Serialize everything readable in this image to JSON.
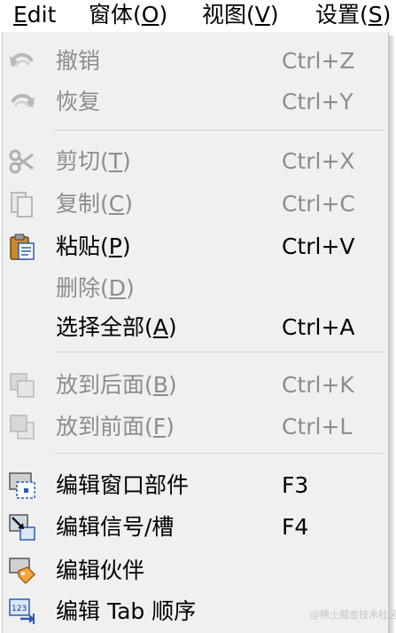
{
  "menubar": {
    "edit": {
      "accel": "E",
      "rest": "dit"
    },
    "window": {
      "pre": "窗体(",
      "accel": "O",
      "post": ")"
    },
    "view": {
      "pre": "视图(",
      "accel": "V",
      "post": ")"
    },
    "settings": {
      "pre": "设置(",
      "accel": "S",
      "post": ")"
    }
  },
  "menu": {
    "undo": {
      "label": "撤销",
      "shortcut": "Ctrl+Z",
      "icon": "undo-icon",
      "enabled": false
    },
    "redo": {
      "label": "恢复",
      "shortcut": "Ctrl+Y",
      "icon": "redo-icon",
      "enabled": false
    },
    "cut": {
      "pre": "剪切(",
      "accel": "T",
      "post": ")",
      "shortcut": "Ctrl+X",
      "icon": "scissors-icon",
      "enabled": false
    },
    "copy": {
      "pre": "复制(",
      "accel": "C",
      "post": ")",
      "shortcut": "Ctrl+C",
      "icon": "copy-icon",
      "enabled": false
    },
    "paste": {
      "pre": "粘贴(",
      "accel": "P",
      "post": ")",
      "shortcut": "Ctrl+V",
      "icon": "paste-icon",
      "enabled": true
    },
    "delete": {
      "pre": "删除(",
      "accel": "D",
      "post": ")",
      "enabled": false
    },
    "select_all": {
      "pre": "选择全部(",
      "accel": "A",
      "post": ")",
      "shortcut": "Ctrl+A",
      "enabled": true
    },
    "send_back": {
      "pre": "放到后面(",
      "accel": "B",
      "post": ")",
      "shortcut": "Ctrl+K",
      "icon": "send-to-back-icon",
      "enabled": false
    },
    "bring_front": {
      "pre": "放到前面(",
      "accel": "F",
      "post": ")",
      "shortcut": "Ctrl+L",
      "icon": "bring-to-front-icon",
      "enabled": false
    },
    "edit_widgets": {
      "label": "编辑窗口部件",
      "shortcut": "F3",
      "icon": "edit-widgets-icon",
      "enabled": true
    },
    "edit_signals": {
      "label": "编辑信号/槽",
      "shortcut": "F4",
      "icon": "edit-signals-slots-icon",
      "enabled": true
    },
    "edit_buddies": {
      "label": "编辑伙伴",
      "icon": "edit-buddies-icon",
      "enabled": true
    },
    "edit_tab_order": {
      "label": "编辑 Tab 顺序",
      "icon": "tab-order-icon",
      "enabled": true
    }
  },
  "watermark": "@稀土掘金技术社区"
}
